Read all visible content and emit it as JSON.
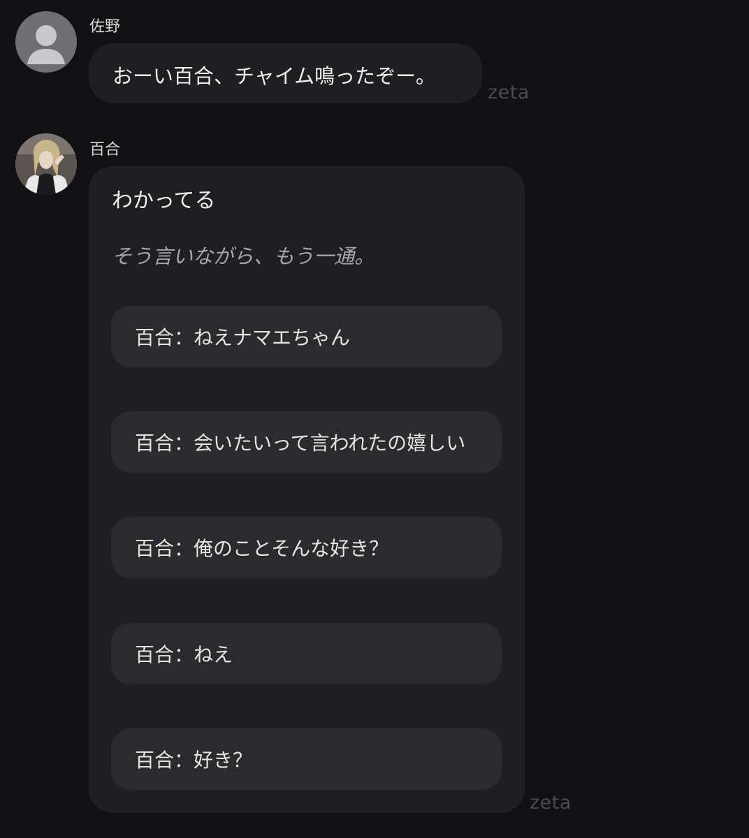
{
  "messages": [
    {
      "sender": "佐野",
      "text": "おーい百合、チャイム鳴ったぞー。",
      "watermark": "zeta"
    },
    {
      "sender": "百合",
      "text": "わかってる",
      "narration": "そう言いながら、もう一通。",
      "quotes": [
        "百合：ねえナマエちゃん",
        "百合：会いたいって言われたの嬉しい",
        "百合：俺のことそんな好き？",
        "百合：ねえ",
        "百合：好き？"
      ],
      "watermark": "zeta"
    }
  ]
}
